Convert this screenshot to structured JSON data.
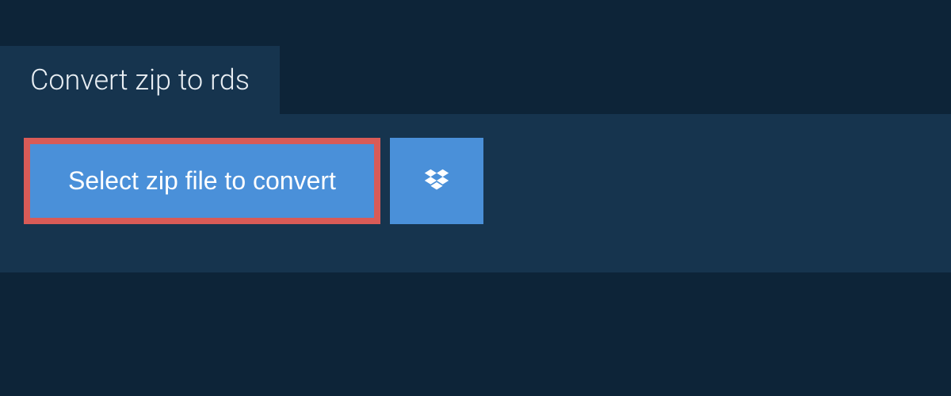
{
  "header": {
    "title": "Convert zip to rds"
  },
  "actions": {
    "select_file_label": "Select zip file to convert",
    "dropbox_icon_name": "dropbox-icon"
  },
  "colors": {
    "page_bg": "#0d2438",
    "panel_bg": "#16344e",
    "button_bg": "#4a90d9",
    "highlight_border": "#d95b57",
    "text_light": "#ffffff"
  }
}
